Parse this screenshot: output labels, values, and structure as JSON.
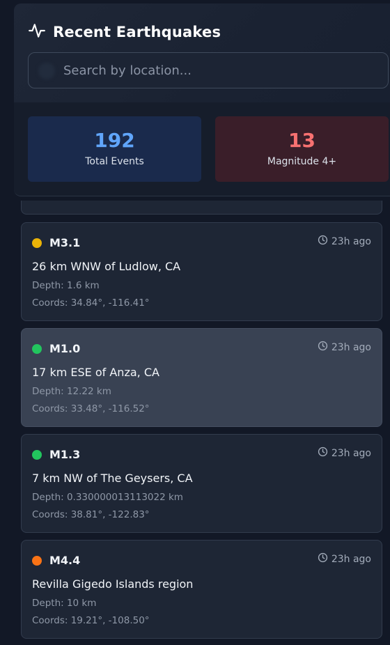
{
  "header": {
    "title": "Recent Earthquakes",
    "icon": "activity-pulse-icon",
    "search_placeholder": "Search by location..."
  },
  "stats": {
    "total": {
      "value": "192",
      "label": "Total Events",
      "color": "#60a5fa"
    },
    "major": {
      "value": "13",
      "label": "Magnitude 4+",
      "color": "#f87171"
    }
  },
  "quakes": [
    {
      "magnitude": "M3.1",
      "color": "#eab308",
      "time": "23h ago",
      "place": "26 km WNW of Ludlow, CA",
      "depth": "Depth: 1.6 km",
      "coords": "Coords: 34.84°, -116.41°",
      "selected": false
    },
    {
      "magnitude": "M1.0",
      "color": "#22c55e",
      "time": "23h ago",
      "place": "17 km ESE of Anza, CA",
      "depth": "Depth: 12.22 km",
      "coords": "Coords: 33.48°, -116.52°",
      "selected": true
    },
    {
      "magnitude": "M1.3",
      "color": "#22c55e",
      "time": "23h ago",
      "place": "7 km NW of The Geysers, CA",
      "depth": "Depth: 0.330000013113022 km",
      "coords": "Coords: 38.81°, -122.83°",
      "selected": false
    },
    {
      "magnitude": "M4.4",
      "color": "#f97316",
      "time": "23h ago",
      "place": "Revilla Gigedo Islands region",
      "depth": "Depth: 10 km",
      "coords": "Coords: 19.21°, -108.50°",
      "selected": false
    }
  ]
}
